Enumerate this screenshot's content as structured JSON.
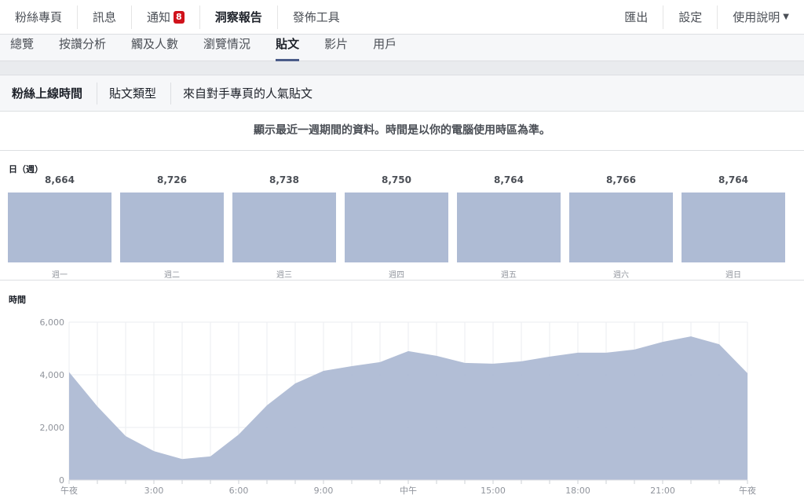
{
  "topnav": {
    "items": [
      "粉絲專頁",
      "訊息",
      "通知",
      "洞察報告",
      "發佈工具"
    ],
    "notification_count": "8",
    "right": [
      "匯出",
      "設定",
      "使用說明"
    ]
  },
  "subnav": {
    "tabs": [
      "總覽",
      "按讚分析",
      "觸及人數",
      "瀏覽情況",
      "貼文",
      "影片",
      "用戶"
    ],
    "active": "貼文"
  },
  "filters": {
    "tabs": [
      "粉絲上線時間",
      "貼文類型",
      "來自對手專頁的人氣貼文"
    ],
    "active": "粉絲上線時間"
  },
  "notice": "顯示最近一週期間的資料。時間是以你的電腦使用時區為準。",
  "days_section": {
    "title": "日（週）",
    "days": [
      {
        "name": "週一",
        "value": "8,664"
      },
      {
        "name": "週二",
        "value": "8,726"
      },
      {
        "name": "週三",
        "value": "8,738"
      },
      {
        "name": "週四",
        "value": "8,750"
      },
      {
        "name": "週五",
        "value": "8,764"
      },
      {
        "name": "週六",
        "value": "8,766"
      },
      {
        "name": "週日",
        "value": "8,764"
      }
    ]
  },
  "chart_data": {
    "type": "area",
    "title": "時間",
    "x": [
      0,
      1,
      2,
      3,
      4,
      5,
      6,
      7,
      8,
      9,
      10,
      11,
      12,
      13,
      14,
      15,
      16,
      17,
      18,
      19,
      20,
      21,
      22,
      23,
      24
    ],
    "values": [
      4100,
      2800,
      1670,
      1100,
      800,
      900,
      1730,
      2840,
      3670,
      4150,
      4330,
      4480,
      4900,
      4720,
      4450,
      4420,
      4510,
      4690,
      4840,
      4840,
      4960,
      5250,
      5460,
      5160,
      4060
    ],
    "ylim": [
      0,
      6000
    ],
    "yticks": [
      {
        "v": 0,
        "label": "0"
      },
      {
        "v": 2000,
        "label": "2,000"
      },
      {
        "v": 4000,
        "label": "4,000"
      },
      {
        "v": 6000,
        "label": "6,000"
      }
    ],
    "xticks": [
      {
        "v": 0,
        "label": "午夜"
      },
      {
        "v": 3,
        "label": "3:00"
      },
      {
        "v": 6,
        "label": "6:00"
      },
      {
        "v": 9,
        "label": "9:00"
      },
      {
        "v": 12,
        "label": "中午"
      },
      {
        "v": 15,
        "label": "15:00"
      },
      {
        "v": 18,
        "label": "18:00"
      },
      {
        "v": 21,
        "label": "21:00"
      },
      {
        "v": 24,
        "label": "午夜"
      }
    ],
    "color": "#aebbd4"
  }
}
